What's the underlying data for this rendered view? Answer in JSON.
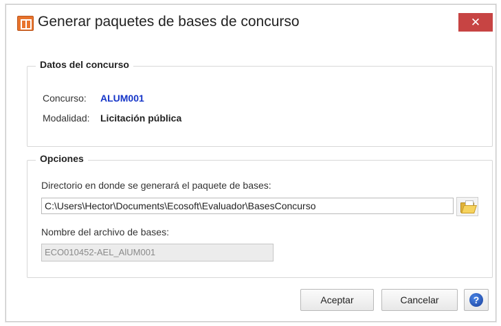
{
  "window": {
    "title": "Generar paquetes de bases de concurso",
    "close_label": "✕"
  },
  "datos": {
    "legend": "Datos del concurso",
    "concurso_label": "Concurso:",
    "concurso_value": "ALUM001",
    "modalidad_label": "Modalidad:",
    "modalidad_value": "Licitación pública"
  },
  "opciones": {
    "legend": "Opciones",
    "directorio_label": "Directorio en donde se generará el paquete de bases:",
    "directorio_value": "C:\\Users\\Hector\\Documents\\Ecosoft\\Evaluador\\BasesConcurso",
    "nombre_label": "Nombre del archivo de bases:",
    "nombre_value": "ECO010452-AEL_AlUM001"
  },
  "buttons": {
    "accept": "Aceptar",
    "cancel": "Cancelar",
    "help": "?"
  },
  "colors": {
    "accent_blue": "#1535c8",
    "close_red": "#c74443",
    "icon_orange": "#e8732c"
  }
}
